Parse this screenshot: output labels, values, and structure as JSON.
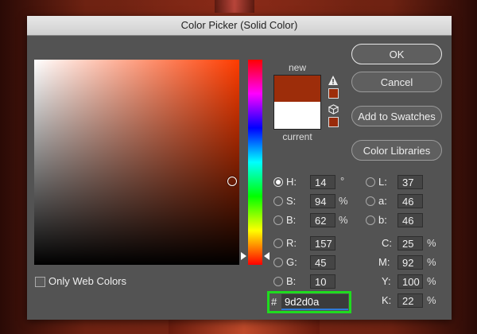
{
  "dialog": {
    "title": "Color Picker (Solid Color)"
  },
  "preview": {
    "new_label": "new",
    "current_label": "current",
    "new_color": "#9d2d0a",
    "current_color": "#ffffff"
  },
  "buttons": {
    "ok": "OK",
    "cancel": "Cancel",
    "add_to_swatches": "Add to Swatches",
    "color_libraries": "Color Libraries"
  },
  "hsb": {
    "h": {
      "label": "H:",
      "value": "14",
      "unit": "°",
      "selected": true
    },
    "s": {
      "label": "S:",
      "value": "94",
      "unit": "%"
    },
    "b": {
      "label": "B:",
      "value": "62",
      "unit": "%"
    }
  },
  "rgb": {
    "r": {
      "label": "R:",
      "value": "157"
    },
    "g": {
      "label": "G:",
      "value": "45"
    },
    "b": {
      "label": "B:",
      "value": "10"
    }
  },
  "lab": {
    "l": {
      "label": "L:",
      "value": "37"
    },
    "a": {
      "label": "a:",
      "value": "46"
    },
    "b": {
      "label": "b:",
      "value": "46"
    }
  },
  "cmyk": {
    "c": {
      "label": "C:",
      "value": "25",
      "unit": "%"
    },
    "m": {
      "label": "M:",
      "value": "92",
      "unit": "%"
    },
    "y": {
      "label": "Y:",
      "value": "100",
      "unit": "%"
    },
    "k": {
      "label": "K:",
      "value": "22",
      "unit": "%"
    }
  },
  "web_colors": {
    "label": "Only Web Colors",
    "checked": false
  },
  "hex": {
    "hash": "#",
    "value": "9d2d0a",
    "highlight_color": "#1fdc1f"
  },
  "icons": {
    "gamut_warning": "warning-triangle-icon",
    "web_safe": "cube-icon"
  }
}
